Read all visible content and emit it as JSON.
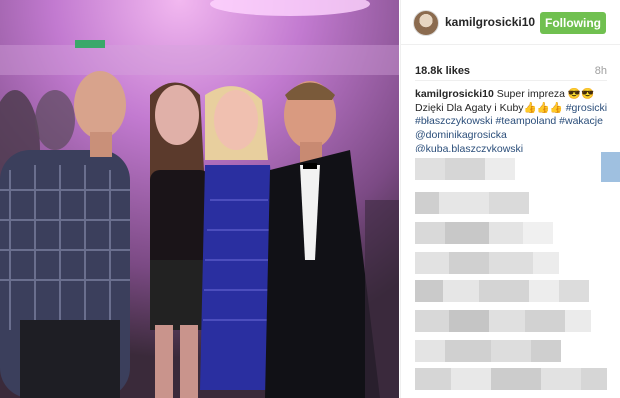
{
  "post": {
    "username": "kamilgrosicki10",
    "follow_label": "Following",
    "likes": "18.8k likes",
    "time": "8h",
    "caption": {
      "author": "kamilgrosicki10",
      "line1": "Super impreza 😎😎",
      "line2": "Dzięki Dla Agaty i Kuby👍👍👍",
      "hashtag1": "#grosicki",
      "hashtag2": "#błaszczykowski",
      "hashtag3": "#teampoland",
      "hashtag4": "#wakacje",
      "mention1": "@dominikagrosicka",
      "mention2": "@kuba.blaszczykowski"
    }
  },
  "colors": {
    "follow_button": "#70c050",
    "hashtag": "#2b4e7a",
    "photo_light": "#c060d0"
  },
  "icons": {
    "avatar": "profile-avatar"
  }
}
